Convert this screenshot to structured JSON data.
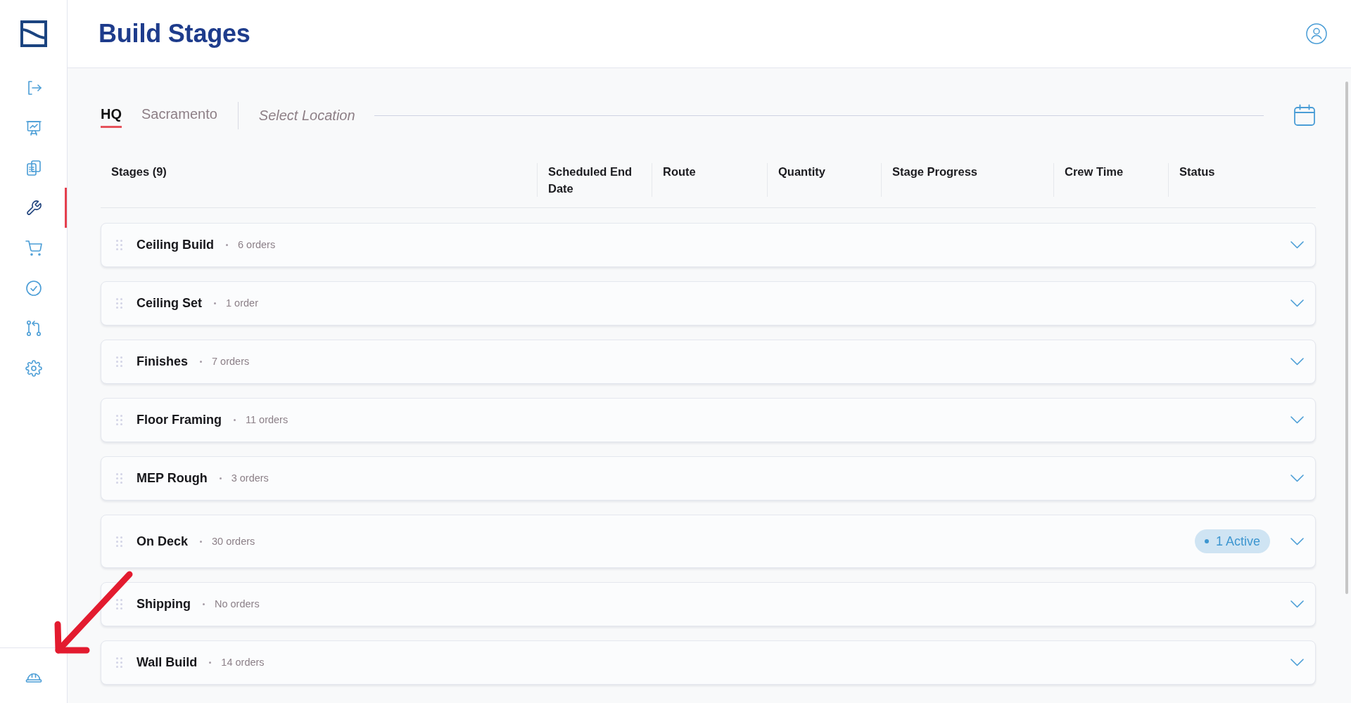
{
  "sidebar": {
    "items": [
      {
        "kind": "exit",
        "selected": false
      },
      {
        "kind": "presentation",
        "selected": false
      },
      {
        "kind": "clipboard",
        "selected": false
      },
      {
        "kind": "wrench",
        "selected": true
      },
      {
        "kind": "cart",
        "selected": false
      },
      {
        "kind": "check",
        "selected": false
      },
      {
        "kind": "merge",
        "selected": false
      },
      {
        "kind": "gear",
        "selected": false
      }
    ],
    "footer_items": [
      {
        "kind": "helmet",
        "selected": false
      }
    ]
  },
  "header": {
    "title": "Build Stages"
  },
  "location_tabs": [
    {
      "label": "HQ",
      "selected": true
    },
    {
      "label": "Sacramento",
      "selected": false
    }
  ],
  "location_select": {
    "placeholder": "Select Location"
  },
  "table": {
    "columns": [
      "Stages (9)",
      "Scheduled End Date",
      "Route",
      "Quantity",
      "Stage Progress",
      "Crew Time",
      "Status"
    ],
    "rows": [
      {
        "name": "Ceiling Build",
        "orders": "6 orders",
        "expanded": false
      },
      {
        "name": "Ceiling Set",
        "orders": "1 order",
        "expanded": false
      },
      {
        "name": "Finishes",
        "orders": "7 orders",
        "expanded": false
      },
      {
        "name": "Floor Framing",
        "orders": "11 orders",
        "expanded": false
      },
      {
        "name": "MEP Rough",
        "orders": "3 orders",
        "expanded": false
      },
      {
        "name": "On Deck",
        "orders": "30 orders",
        "badge": "1 Active",
        "expanded": false
      },
      {
        "name": "Shipping",
        "orders": "No orders",
        "expanded": false
      },
      {
        "name": "Wall Build",
        "orders": "14 orders",
        "expanded": false
      }
    ]
  }
}
